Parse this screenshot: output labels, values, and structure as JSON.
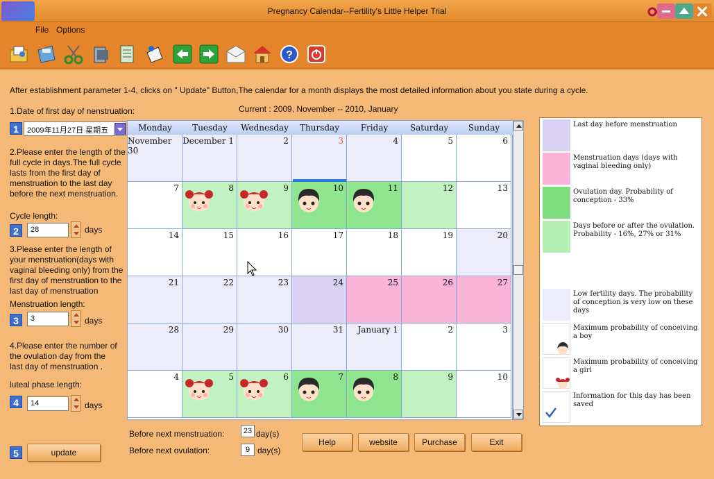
{
  "window": {
    "title": "Pregnancy Calendar--Fertility's Little Helper  Trial"
  },
  "menu": {
    "file": "File",
    "options": "Options"
  },
  "toolbar": {
    "icons": [
      "open-icon",
      "save-icon",
      "cut-icon",
      "print-icon",
      "notes-icon",
      "history-icon",
      "back-icon",
      "forward-icon",
      "mail-icon",
      "home-icon",
      "help-icon",
      "exit-icon"
    ]
  },
  "intro": "After establishment parameter 1-4, clicks on \" Update\" Button,The calendar for a month displays the most detailed information about you state during a cycle.",
  "current_range": "Current : 2009, November -- 2010, January",
  "step1": {
    "num": "1",
    "label": "1.Date of first  day of nenstruation:",
    "date_value": "2009年11月27日  星期五"
  },
  "step2": {
    "num": "2",
    "label": "2.Please enter the length of the full cycle in days.The full cycle lasts from the first day of menstruation to the last day before the next menstruation.",
    "field_label": "Cycle length:",
    "value": "28",
    "unit": "days"
  },
  "step3": {
    "num": "3",
    "label": "3.Please enter the length of your menstruation(days with vaginal bleeding only) from the first day of menstruation to the last day of menstruation",
    "field_label": "Menstruation length:",
    "value": "3",
    "unit": "days"
  },
  "step4": {
    "num": "4",
    "label": "4.Please enter the number of the ovulation day from the last day of menstruation .",
    "field_label": "luteal phase length:",
    "value": "14",
    "unit": "days"
  },
  "step5": {
    "num": "5",
    "button": "update"
  },
  "calendar": {
    "weekdays": [
      "Monday",
      "Tuesday",
      "Wednesday",
      "Thursday",
      "Friday",
      "Saturday",
      "Sunday"
    ],
    "rows": [
      [
        {
          "d": "November 30",
          "t": "low"
        },
        {
          "d": "December 1",
          "t": "low"
        },
        {
          "d": "2",
          "t": "low"
        },
        {
          "d": "3",
          "t": "low",
          "red": true
        },
        {
          "d": "4",
          "t": "low"
        },
        {
          "d": "5",
          "t": "white"
        },
        {
          "d": "6",
          "t": "white"
        }
      ],
      [
        {
          "d": "7",
          "t": "white"
        },
        {
          "d": "8",
          "t": "near",
          "face": "girl"
        },
        {
          "d": "9",
          "t": "near",
          "face": "girl"
        },
        {
          "d": "10",
          "t": "ovu",
          "face": "boy"
        },
        {
          "d": "11",
          "t": "ovu",
          "face": "boy"
        },
        {
          "d": "12",
          "t": "near"
        },
        {
          "d": "13",
          "t": "white"
        }
      ],
      [
        {
          "d": "14",
          "t": "white"
        },
        {
          "d": "15",
          "t": "white"
        },
        {
          "d": "16",
          "t": "white"
        },
        {
          "d": "17",
          "t": "white"
        },
        {
          "d": "18",
          "t": "white"
        },
        {
          "d": "19",
          "t": "white"
        },
        {
          "d": "20",
          "t": "low"
        }
      ],
      [
        {
          "d": "21",
          "t": "low"
        },
        {
          "d": "22",
          "t": "low"
        },
        {
          "d": "23",
          "t": "low"
        },
        {
          "d": "24",
          "t": "last"
        },
        {
          "d": "25",
          "t": "mens"
        },
        {
          "d": "26",
          "t": "mens"
        },
        {
          "d": "27",
          "t": "mens"
        }
      ],
      [
        {
          "d": "28",
          "t": "low"
        },
        {
          "d": "29",
          "t": "low"
        },
        {
          "d": "30",
          "t": "low"
        },
        {
          "d": "31",
          "t": "low"
        },
        {
          "d": "January 1",
          "t": "low"
        },
        {
          "d": "2",
          "t": "white"
        },
        {
          "d": "3",
          "t": "white"
        }
      ],
      [
        {
          "d": "4",
          "t": "white"
        },
        {
          "d": "5",
          "t": "near",
          "face": "girl"
        },
        {
          "d": "6",
          "t": "near",
          "face": "girl"
        },
        {
          "d": "7",
          "t": "ovu",
          "face": "boy"
        },
        {
          "d": "8",
          "t": "ovu",
          "face": "boy"
        },
        {
          "d": "9",
          "t": "near"
        },
        {
          "d": "10",
          "t": "white"
        }
      ]
    ]
  },
  "legend": [
    {
      "color": "#d9d2f3",
      "text": "Last day before menstruation"
    },
    {
      "color": "#f9b4d8",
      "text": "Menstruation days (days with vaginal bleeding only)"
    },
    {
      "color": "#7fdd7f",
      "text": "Ovulation day. Probability of conception - 33%"
    },
    {
      "color": "#b6efb6",
      "text": "Days before or after the ovulation. Probability - 16%, 27% or 31%"
    },
    {
      "color": "#ffffff",
      "text": ""
    },
    {
      "color": "#ececfb",
      "text": "Low fertility days. The probability of conception is very low on these days"
    },
    {
      "color": "#ffffff",
      "text": "Maximum probability of conceiving a boy",
      "icon": "boy-face-icon"
    },
    {
      "color": "#ffffff",
      "text": "Maximum probability of conceiving a girl",
      "icon": "girl-face-icon"
    },
    {
      "color": "#ffffff",
      "text": "Information for this day has been saved",
      "icon": "checkmark-icon"
    }
  ],
  "status": {
    "mens_label": "Before next  menstruation:",
    "mens_value": "23",
    "mens_unit": "day(s)",
    "ovu_label": "Before next ovulation:",
    "ovu_value": "9",
    "ovu_unit": "day(s)"
  },
  "buttons": {
    "help": "Help",
    "website": "website",
    "purchase": "Purchase",
    "exit": "Exit"
  },
  "colors": {
    "low": "#ececfb",
    "near": "#c2f1c2",
    "ovu": "#8ee58e",
    "last": "#d9d2f3",
    "mens": "#f9b4d8",
    "white": "#ffffff"
  }
}
